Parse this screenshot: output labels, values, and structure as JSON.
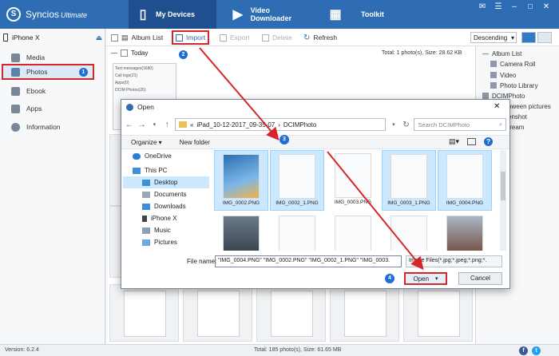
{
  "app": {
    "title": "Syncios",
    "title_suffix": "Ultimate"
  },
  "nav": {
    "my_devices": "My Devices",
    "video_downloader": "Video Downloader",
    "toolkit": "Toolkit"
  },
  "device": {
    "name": "iPhone X"
  },
  "sidebar": {
    "items": [
      {
        "label": "Media",
        "icon": "media-icon"
      },
      {
        "label": "Photos",
        "icon": "photos-icon"
      },
      {
        "label": "Ebook",
        "icon": "ebook-icon"
      },
      {
        "label": "Apps",
        "icon": "apps-icon"
      },
      {
        "label": "Information",
        "icon": "info-icon"
      }
    ]
  },
  "badges": {
    "b1": "1",
    "b2": "2",
    "b3": "3",
    "b4": "4"
  },
  "toolbar": {
    "album_list": "Album List",
    "import": "Import",
    "export": "Export",
    "delete": "Delete",
    "refresh": "Refresh",
    "sort": "Descending"
  },
  "content": {
    "today": "Today",
    "total_today": "Total: 1 photo(s), Size: 28.62 KB",
    "message_list": [
      "Text messages(1680)",
      "Call logs(21)",
      "Apps(0)",
      "DCIM Photos(26)"
    ]
  },
  "album_panel": {
    "title": "Album List",
    "items": [
      "Camera Roll",
      "Video",
      "Photo Library",
      "DCIMPhoto",
      "oween pictures",
      "enshot",
      "tream"
    ]
  },
  "status": {
    "version": "Version: 6.2.4",
    "total": "Total: 185 photo(s), Size: 61.65 MB"
  },
  "dialog": {
    "title": "Open",
    "path_prefix": "«",
    "path_folder": "iPad_10-12-2017_09-35-07",
    "path_separator": "›",
    "path_current": "DCIMPhoto",
    "search_placeholder": "Search DCIMPhoto",
    "organize": "Organize ▾",
    "new_folder": "New folder",
    "tree": [
      {
        "label": "OneDrive",
        "icon": "cloud-icon"
      },
      {
        "label": "This PC",
        "icon": "computer-icon"
      },
      {
        "label": "Desktop",
        "icon": "folder-icon"
      },
      {
        "label": "Documents",
        "icon": "documents-icon"
      },
      {
        "label": "Downloads",
        "icon": "downloads-icon"
      },
      {
        "label": "iPhone X",
        "icon": "phone-icon"
      },
      {
        "label": "Music",
        "icon": "music-icon"
      },
      {
        "label": "Pictures",
        "icon": "pictures-icon"
      }
    ],
    "files": [
      {
        "name": "IMG_0002.PNG",
        "selected": true
      },
      {
        "name": "IMG_0002_1.PNG",
        "selected": true
      },
      {
        "name": "IMG_0003.PNG",
        "selected": false
      },
      {
        "name": "IMG_0003_1.PNG",
        "selected": true
      },
      {
        "name": "IMG_0004.PNG",
        "selected": true
      }
    ],
    "file_name_label": "File name:",
    "file_name_value": "\"IMG_0004.PNG\" \"IMG_0002.PNG\" \"IMG_0002_1.PNG\" \"IMG_0003.",
    "file_type": "Image Files(*.jpg;*.jpeg;*.png;*.",
    "open": "Open",
    "cancel": "Cancel"
  },
  "colors": {
    "brand": "#2e6db4",
    "highlight": "#d6262b",
    "badge": "#1f6fd2",
    "selection": "#cce8ff"
  }
}
